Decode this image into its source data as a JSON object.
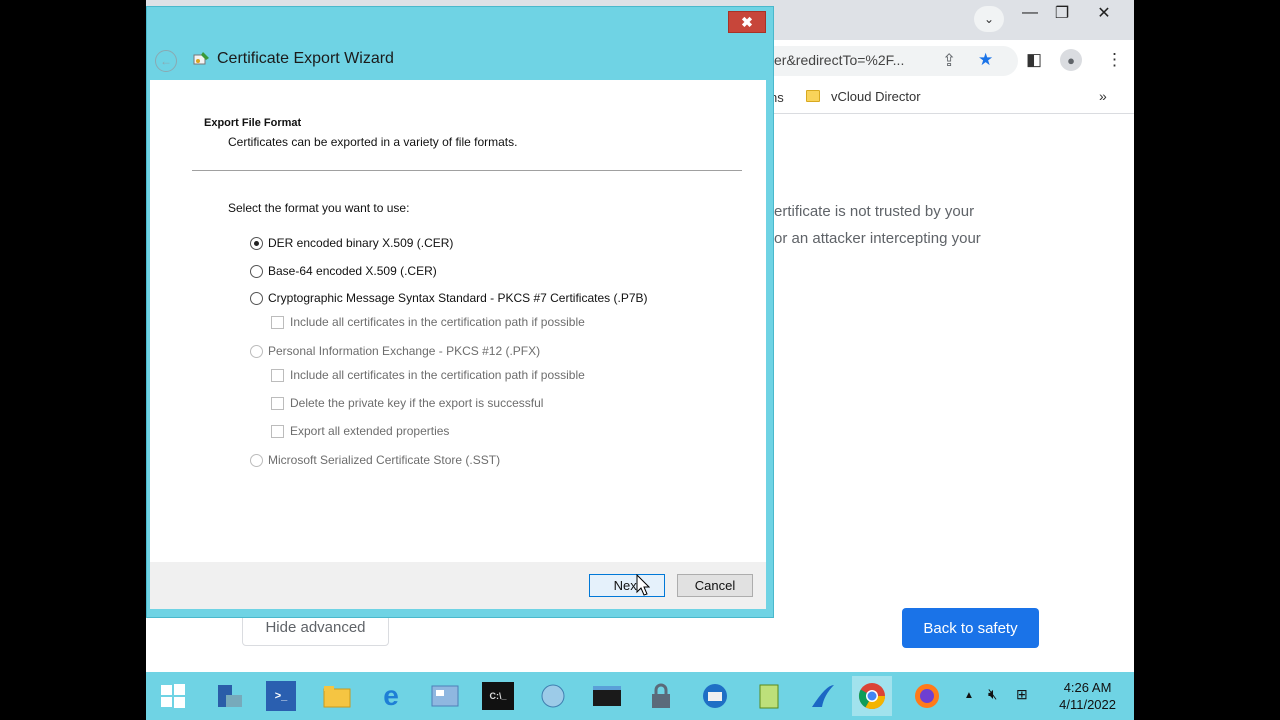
{
  "browser": {
    "address_fragment": "er&redirectTo=%2F...",
    "bookmark_partial": "ns",
    "bookmark_label": "vCloud Director",
    "warning_line1": "ertificate is not trusted by your",
    "warning_line2": "or an attacker intercepting your",
    "hide_advanced_label": "Hide advanced",
    "back_to_safety_label": "Back to safety",
    "accent_color": "#1a73e8"
  },
  "wizard": {
    "title": "Certificate Export Wizard",
    "section_title": "Export File Format",
    "section_subtitle": "Certificates can be exported in a variety of file formats.",
    "prompt": "Select the format you want to use:",
    "options": [
      {
        "label": "DER encoded binary X.509 (.CER)",
        "checked": true,
        "enabled": true
      },
      {
        "label": "Base-64 encoded X.509 (.CER)",
        "checked": false,
        "enabled": true
      },
      {
        "label": "Cryptographic Message Syntax Standard - PKCS #7 Certificates (.P7B)",
        "checked": false,
        "enabled": true
      },
      {
        "label": "Personal Information Exchange - PKCS #12 (.PFX)",
        "checked": false,
        "enabled": false
      },
      {
        "label": "Microsoft Serialized Certificate Store (.SST)",
        "checked": false,
        "enabled": false
      }
    ],
    "checkboxes": [
      {
        "label": "Include all certificates in the certification path if possible",
        "checked": false,
        "enabled": false
      },
      {
        "label": "Include all certificates in the certification path if possible",
        "checked": false,
        "enabled": false
      },
      {
        "label": "Delete the private key if the export is successful",
        "checked": false,
        "enabled": false
      },
      {
        "label": "Export all extended properties",
        "checked": false,
        "enabled": false
      }
    ],
    "next_label": "Next",
    "cancel_label": "Cancel",
    "close_glyph": "✖",
    "title_color": "#6fd3e4"
  },
  "taskbar": {
    "time": "4:26 AM",
    "date": "4/11/2022",
    "apps": [
      "windows-start",
      "server-manager",
      "powershell",
      "file-explorer",
      "internet-explorer",
      "control-panel",
      "command-prompt",
      "network",
      "terminal",
      "lock-tool",
      "thunderbird",
      "notepad-plus-plus",
      "wireshark",
      "chrome",
      "firefox"
    ]
  }
}
